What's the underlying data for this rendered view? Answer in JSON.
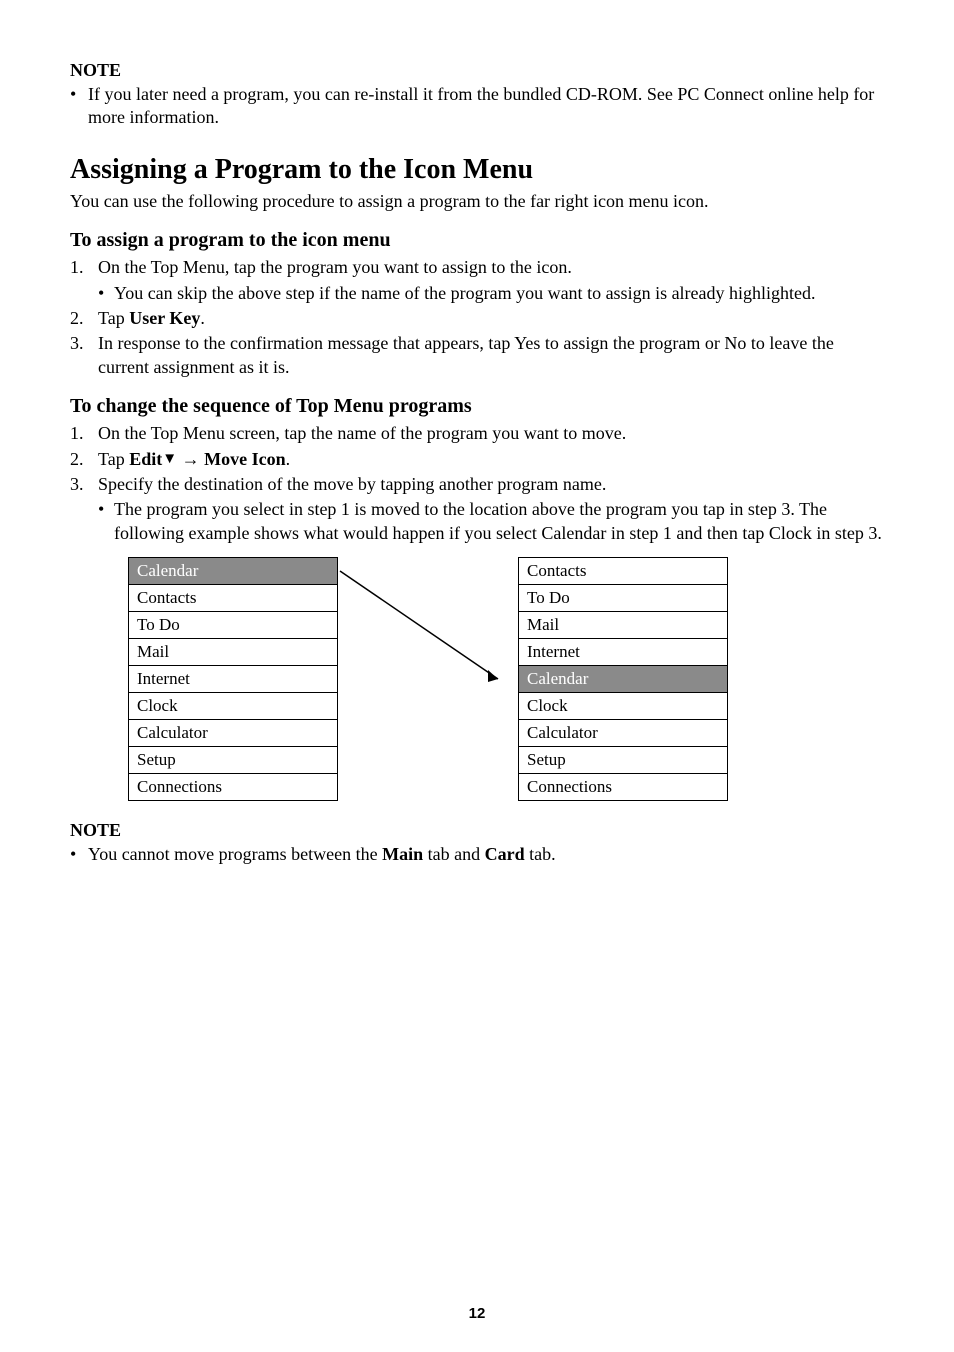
{
  "note1": {
    "label": "NOTE",
    "bullet": "If you later need a program, you can re-install it from the bundled CD-ROM. See PC Connect online help for more information."
  },
  "section": {
    "title": "Assigning a Program to the Icon Menu",
    "intro": "You can use the following procedure to assign a program to the far right icon menu icon."
  },
  "sub1": {
    "heading": "To assign a program to the icon menu",
    "step1": "On the Top Menu, tap the program you want to assign to the icon.",
    "step1_bullet": "You can skip the above step if the name of the program you want to assign is already highlighted.",
    "step2_pre": "Tap ",
    "step2_bold": "User Key",
    "step2_post": ".",
    "step3": "In response to the confirmation message that appears, tap Yes to assign the program or No to leave the current assignment as it is."
  },
  "sub2": {
    "heading": "To change the sequence of Top Menu programs",
    "step1": "On the Top Menu screen, tap the name of the program you want to move.",
    "step2_pre": "Tap ",
    "step2_b1": "Edit",
    "step2_arrow": " → ",
    "step2_b2": "Move Icon",
    "step2_post": ".",
    "step3": "Specify the destination of the move by tapping another program name.",
    "step3_bullet": "The program you select in step 1 is moved to the location above the program you tap in step 3. The following example shows what would happen if you select Calendar in step 1 and then tap Clock in step 3."
  },
  "table_left": [
    "Calendar",
    "Contacts",
    "To Do",
    "Mail",
    "Internet",
    "Clock",
    "Calculator",
    "Setup",
    "Connections"
  ],
  "table_right": [
    "Contacts",
    "To Do",
    "Mail",
    "Internet",
    "Calendar",
    "Clock",
    "Calculator",
    "Setup",
    "Connections"
  ],
  "highlight_left_index": 0,
  "highlight_right_index": 4,
  "note2": {
    "label": "NOTE",
    "pre": "You cannot move programs between the ",
    "b1": "Main",
    "mid": " tab and ",
    "b2": "Card",
    "post": " tab."
  },
  "page_number": "12"
}
